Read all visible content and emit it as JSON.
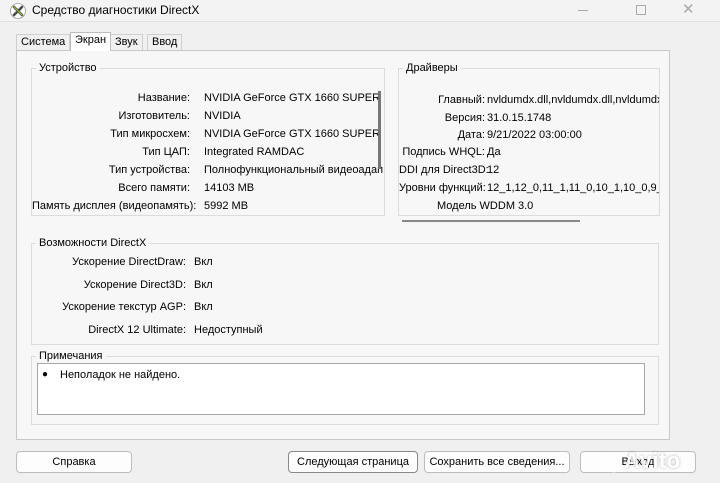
{
  "window": {
    "title": "Средство диагностики DirectX",
    "icon": "directx-x-icon"
  },
  "tabs": [
    {
      "label": "Система",
      "active": false
    },
    {
      "label": "Экран",
      "active": true
    },
    {
      "label": "Звук",
      "active": false
    },
    {
      "label": "Ввод",
      "active": false
    }
  ],
  "device": {
    "title": "Устройство",
    "rows": [
      {
        "label": "Название:",
        "value": "NVIDIA GeForce GTX 1660 SUPER"
      },
      {
        "label": "Изготовитель:",
        "value": "NVIDIA"
      },
      {
        "label": "Тип микросхем:",
        "value": "NVIDIA GeForce GTX 1660 SUPER"
      },
      {
        "label": "Тип ЦАП:",
        "value": "Integrated RAMDAC"
      },
      {
        "label": "Тип устройства:",
        "value": "Полнофункциональный видеоадап"
      },
      {
        "label": "Всего памяти:",
        "value": "14103 MB"
      },
      {
        "label": "Память дисплея (видеопамять):",
        "value": "5992 MB"
      }
    ]
  },
  "drivers": {
    "title": "Драйверы",
    "rows": [
      {
        "label": "Главный:",
        "value": "nvldumdx.dll,nvldumdx.dll,nvldumdx.d"
      },
      {
        "label": "Версия:",
        "value": "31.0.15.1748"
      },
      {
        "label": "Дата:",
        "value": "9/21/2022 03:00:00"
      },
      {
        "label": "Подпись WHQL:",
        "value": "Да"
      },
      {
        "label": "DDI для Direct3D:",
        "value": "12"
      },
      {
        "label": "Уровни функций:",
        "value": "12_1,12_0,11_1,11_0,10_1,10_0,9_3"
      },
      {
        "label": "Модель WDDM",
        "value": "3.0"
      }
    ]
  },
  "features": {
    "title": "Возможности DirectX",
    "rows": [
      {
        "label": "Ускорение DirectDraw:",
        "value": "Вкл"
      },
      {
        "label": "Ускорение Direct3D:",
        "value": "Вкл"
      },
      {
        "label": "Ускорение текстур AGP:",
        "value": "Вкл"
      },
      {
        "label": "DirectX 12 Ultimate:",
        "value": "Недоступный"
      }
    ]
  },
  "notes": {
    "title": "Примечания",
    "items": [
      "Неполадок не найдено."
    ]
  },
  "buttons": {
    "help": "Справка",
    "next_page": "Следующая страница",
    "save_all": "Сохранить все сведения...",
    "exit": "Выход"
  },
  "watermark": {
    "text": "Avito"
  }
}
